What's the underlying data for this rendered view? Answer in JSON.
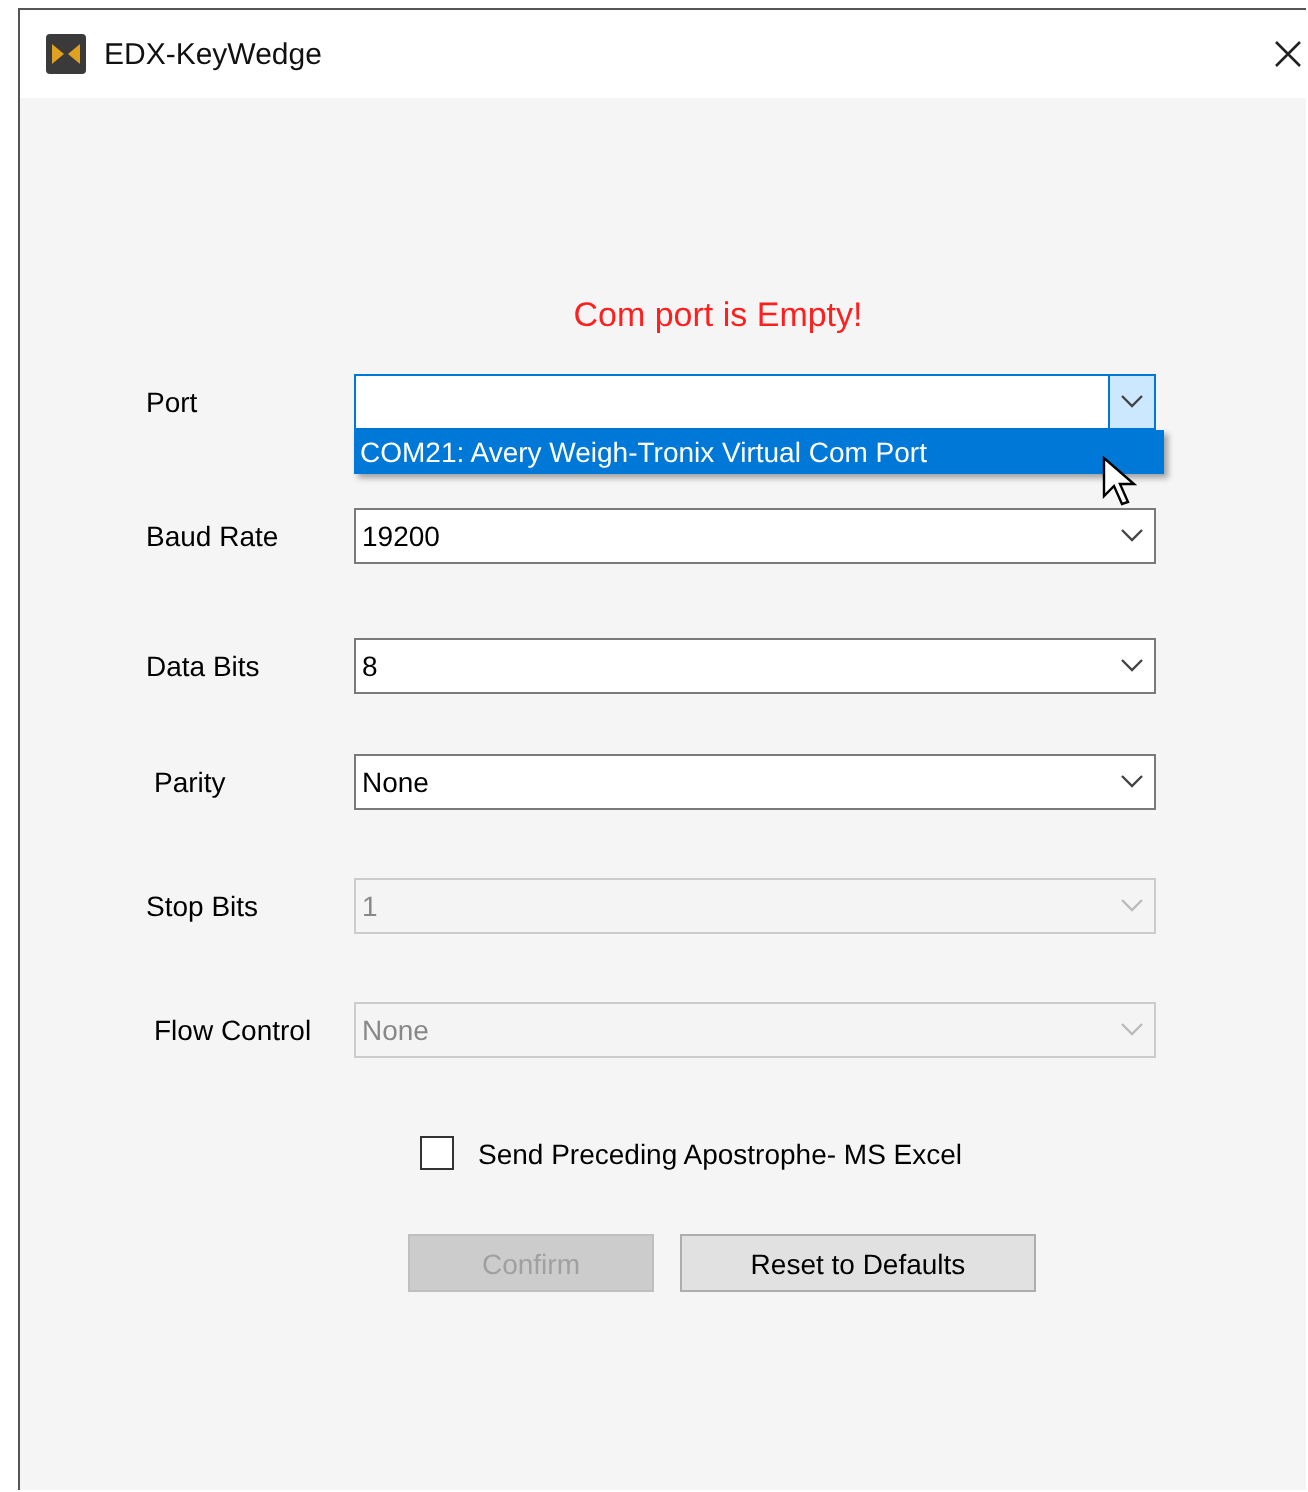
{
  "window": {
    "title": "EDX-KeyWedge"
  },
  "error_message": "Com port is Empty!",
  "fields": [
    {
      "label": "Port",
      "disabled": false,
      "focused": true,
      "options": [
        {
          "label": "COM21: Avery Weigh-Tronix Virtual Com Port",
          "selected": true
        }
      ]
    },
    {
      "label": "Baud Rate",
      "value": "19200",
      "disabled": false,
      "focused": false
    },
    {
      "label": "Data Bits",
      "value": "8",
      "disabled": false,
      "focused": false
    },
    {
      "label": "Parity",
      "value": "None",
      "disabled": false,
      "focused": false
    },
    {
      "label": "Stop Bits",
      "value": "1",
      "disabled": true,
      "focused": false
    },
    {
      "label": "Flow Control",
      "value": "None",
      "disabled": true,
      "focused": false
    }
  ],
  "checkbox": {
    "label": "Send Preceding Apostrophe- MS Excel",
    "checked": false
  },
  "buttons": [
    {
      "label": "Confirm",
      "disabled": true
    },
    {
      "label": "Reset to Defaults",
      "disabled": false
    }
  ]
}
